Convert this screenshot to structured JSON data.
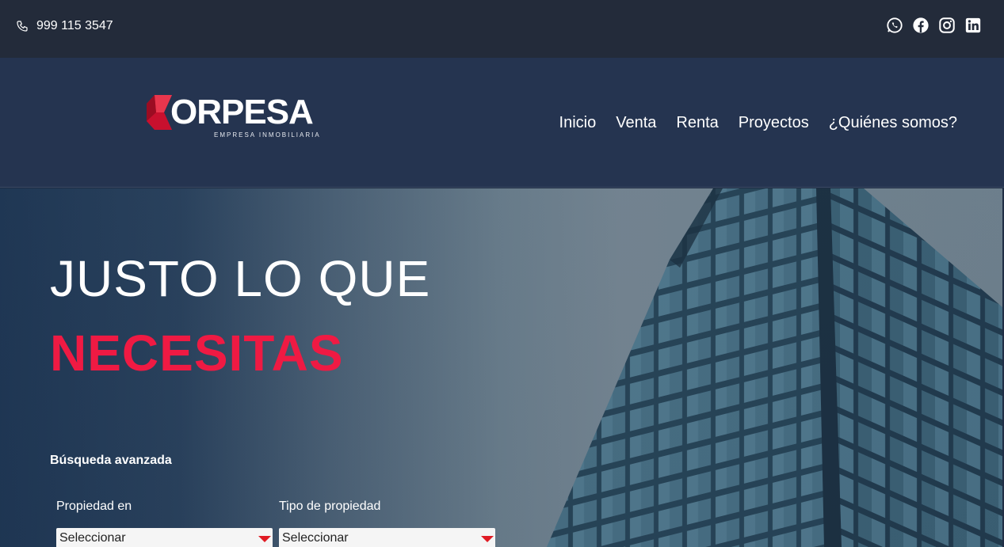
{
  "topbar": {
    "phone": "999 115 3547",
    "social": [
      "whatsapp-icon",
      "facebook-icon",
      "instagram-icon",
      "linkedin-icon"
    ]
  },
  "brand": {
    "name": "ORPESA",
    "tagline": "EMPRESA INMOBILIARIA",
    "colors": {
      "accent": "#e01b24",
      "nav_bg": "#253450",
      "topbar_bg": "#232b3a"
    }
  },
  "nav": {
    "items": [
      "Inicio",
      "Venta",
      "Renta",
      "Proyectos",
      "¿Quiénes somos?"
    ]
  },
  "hero": {
    "line1": "JUSTO LO QUE",
    "line2": "NECESITAS",
    "accent_color": "#ef1a43"
  },
  "search": {
    "title": "Búsqueda avanzada",
    "fields": [
      {
        "label": "Propiedad en",
        "value": "Seleccionar"
      },
      {
        "label": "Tipo de propiedad",
        "value": "Seleccionar"
      }
    ]
  }
}
